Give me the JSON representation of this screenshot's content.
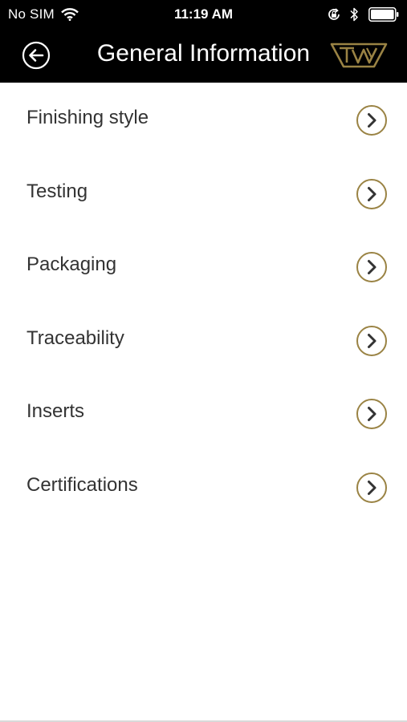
{
  "status_bar": {
    "carrier": "No SIM",
    "time": "11:19 AM",
    "icons": [
      "wifi-icon",
      "lock-rotation-icon",
      "bluetooth-icon",
      "battery-icon"
    ]
  },
  "nav": {
    "title": "General Information",
    "back_icon": "back-arrow-circle-icon",
    "logo_icon": "brand-logo-icon"
  },
  "menu": {
    "items": [
      {
        "label": "Finishing style"
      },
      {
        "label": "Testing"
      },
      {
        "label": "Packaging"
      },
      {
        "label": "Traceability"
      },
      {
        "label": "Inserts"
      },
      {
        "label": "Certifications"
      }
    ],
    "chevron_icon": "chevron-right-circle-icon"
  },
  "colors": {
    "bar_background": "#000000",
    "accent_gold": "#9a8344",
    "text": "#333333",
    "background": "#ffffff"
  }
}
